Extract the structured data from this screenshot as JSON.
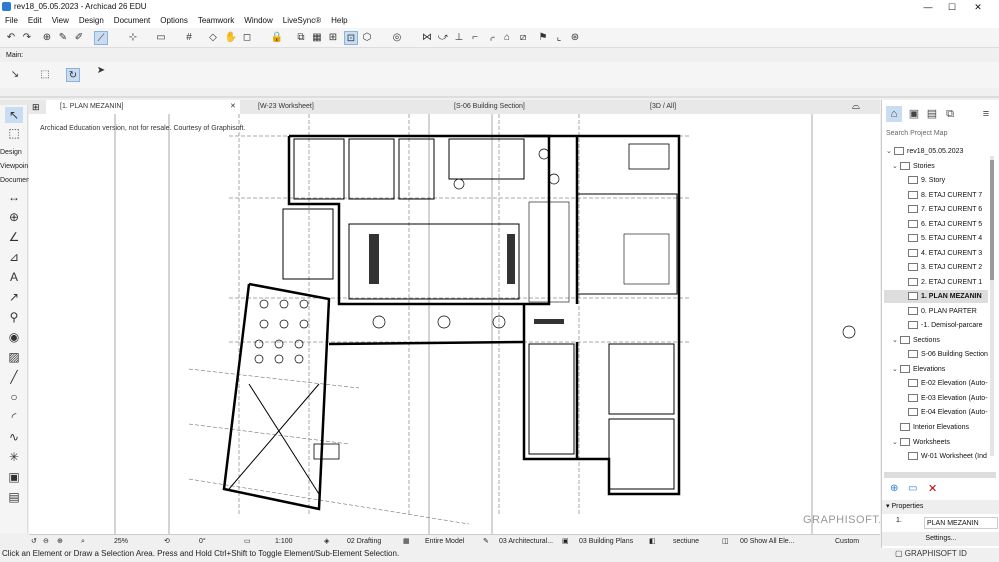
{
  "window": {
    "title": "rev18_05.05.2023 - Archicad 26 EDU"
  },
  "menu": [
    "File",
    "Edit",
    "View",
    "Design",
    "Document",
    "Options",
    "Teamwork",
    "Window",
    "LiveSync®",
    "Help"
  ],
  "toolbar": {
    "main_label": "Main:"
  },
  "tabs": [
    {
      "label": "[1. PLAN MEZANIN]"
    },
    {
      "label": "[W-23 Worksheet]"
    },
    {
      "label": "[S-06 Building Section]"
    },
    {
      "label": "[3D / All]"
    }
  ],
  "toolbox": {
    "labels": [
      "Design",
      "Viewpoin",
      "Documen"
    ]
  },
  "canvas": {
    "watermark": "Archicad Education version, not for resale. Courtesy of Graphisoft.",
    "brand": "GRAPHISOFT."
  },
  "statusbar": {
    "zoom": "25%",
    "angle": "0°",
    "scale": "1:100",
    "layer_combo": "02 Drafting",
    "model_view": "Entire Model",
    "pen_set": "03 Architectural...",
    "view_set": "03 Building Plans",
    "override": "sectiune",
    "renovation": "00 Show All Ele...",
    "custom": "Custom"
  },
  "hint": "Click an Element or Draw a Selection Area. Press and Hold Ctrl+Shift to Toggle Element/Sub-Element Selection.",
  "project_map": {
    "search_placeholder": "Search Project Map",
    "root": "rev18_05.05.2023",
    "stories_label": "Stories",
    "stories": [
      "9. Story",
      "8. ETAJ CURENT 7",
      "7. ETAJ CURENT 6",
      "6. ETAJ CURENT 5",
      "5. ETAJ CURENT 4",
      "4. ETAJ CURENT 3",
      "3. ETAJ CURENT 2",
      "2. ETAJ CURENT 1",
      "1. PLAN MEZANIN",
      "0. PLAN PARTER",
      "-1. Demisol-parcare"
    ],
    "selected_story": "1. PLAN MEZANIN",
    "sections_label": "Sections",
    "sections": [
      "S-06 Building Section"
    ],
    "elevations_label": "Elevations",
    "elevations": [
      "E-02 Elevation (Auto-",
      "E-03 Elevation (Auto-",
      "E-04 Elevation (Auto-"
    ],
    "interior_label": "Interior Elevations",
    "worksheets_label": "Worksheets",
    "worksheets": [
      "W-01 Worksheet (Ind"
    ]
  },
  "properties": {
    "header": "Properties",
    "id": "1.",
    "name": "PLAN MEZANIN",
    "settings_label": "Settings..."
  },
  "graphisoft_id": "GRAPHISOFT ID"
}
